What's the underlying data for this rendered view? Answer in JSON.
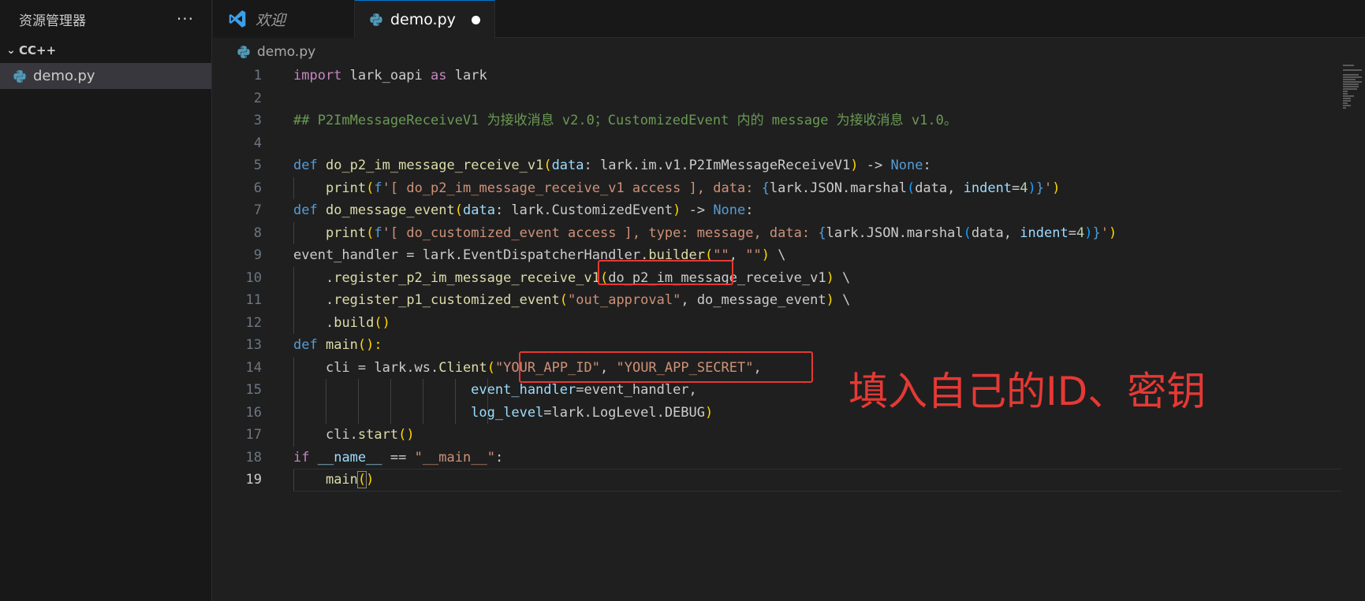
{
  "sidebar": {
    "title": "资源管理器",
    "more": "···",
    "folder": "CC++",
    "file": "demo.py"
  },
  "tabs": [
    {
      "label": "欢迎"
    },
    {
      "label": "demo.py"
    }
  ],
  "breadcrumb": "demo.py",
  "editor": {
    "current_line": 19,
    "lines": [
      {
        "n": "1"
      },
      {
        "n": "2"
      },
      {
        "n": "3"
      },
      {
        "n": "4"
      },
      {
        "n": "5"
      },
      {
        "n": "6"
      },
      {
        "n": "7"
      },
      {
        "n": "8"
      },
      {
        "n": "9"
      },
      {
        "n": "10"
      },
      {
        "n": "11"
      },
      {
        "n": "12"
      },
      {
        "n": "13"
      },
      {
        "n": "14"
      },
      {
        "n": "15"
      },
      {
        "n": "16"
      },
      {
        "n": "17"
      },
      {
        "n": "18"
      },
      {
        "n": "19"
      }
    ],
    "code": {
      "l1": [
        "import",
        " lark_oapi ",
        "as",
        " lark"
      ],
      "l3": "## P2ImMessageReceiveV1 为接收消息 v2.0；CustomizedEvent 内的 message 为接收消息 v1.0。",
      "l5": [
        "def",
        " ",
        "do_p2_im_message_receive_v1",
        "(",
        "data",
        ": lark.im.v1.P2ImMessageReceiveV1",
        ")",
        " -> ",
        "None",
        ":"
      ],
      "l6": [
        "print",
        "(",
        "f",
        "'[ do_p2_im_message_receive_v1 access ], data: ",
        "{",
        "lark.JSON.marshal",
        "(",
        "data",
        ", ",
        "indent",
        "=",
        "4",
        ")",
        "}",
        "'",
        ")"
      ],
      "l7": [
        "def",
        " ",
        "do_message_event",
        "(",
        "data",
        ": lark.CustomizedEvent",
        ")",
        " -> ",
        "None",
        ":"
      ],
      "l8": [
        "print",
        "(",
        "f",
        "'[ do_customized_event access ], type: message, data: ",
        "{",
        "lark.JSON.marshal",
        "(",
        "data",
        ", ",
        "indent",
        "=",
        "4",
        ")",
        "}",
        "'",
        ")"
      ],
      "l9": [
        "event_handler",
        " = lark.EventDispatcherHandler.",
        "builder",
        "(",
        "\"\"",
        ", ",
        "\"\"",
        ")",
        " \\"
      ],
      "l10": [
        ".",
        "register_p2_im_message_receive_v1",
        "(",
        "do_p2_im_message_receive_v1",
        ")",
        " \\"
      ],
      "l11": [
        ".",
        "register_p1_customized_event",
        "(",
        "\"out_approval\"",
        ", ",
        "do_message_event",
        ")",
        " \\"
      ],
      "l12": [
        ".",
        "build",
        "()"
      ],
      "l13": [
        "def",
        " ",
        "main",
        "():"
      ],
      "l14": [
        "cli",
        " = lark.ws.",
        "Client",
        "(",
        "\"YOUR_APP_ID\"",
        ", ",
        "\"YOUR_APP_SECRET\"",
        ","
      ],
      "l15": [
        "event_handler",
        "=",
        "event_handler",
        ","
      ],
      "l16": [
        "log_level",
        "=lark.LogLevel.DEBUG",
        ")"
      ],
      "l17": [
        "cli.",
        "start",
        "()"
      ],
      "l18": [
        "if",
        " ",
        "__name__",
        " == ",
        "\"__main__\"",
        ":"
      ],
      "l19": [
        "main",
        "(",
        ")"
      ]
    }
  },
  "annotation": {
    "text": "填入自己的ID、密钥",
    "color": "#e53935"
  },
  "colors": {
    "accent": "#0078d4",
    "keyword": "#c586c0",
    "storage": "#569cd6",
    "function": "#dcdcaa",
    "variable": "#9cdcfe",
    "string": "#ce9178",
    "comment": "#6a9955"
  }
}
